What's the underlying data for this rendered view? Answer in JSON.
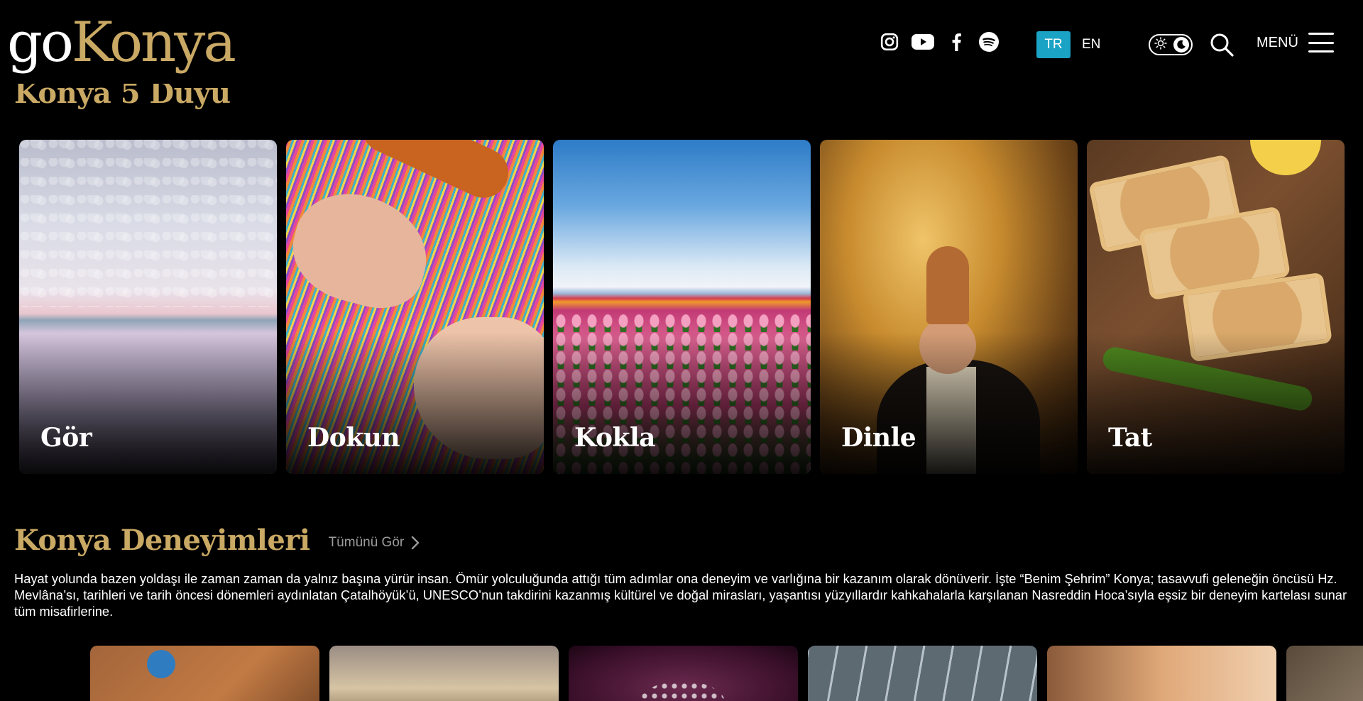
{
  "header": {
    "logo_go": "go",
    "logo_konya": "Konya",
    "social": [
      "instagram-icon",
      "youtube-icon",
      "facebook-icon",
      "spotify-icon"
    ],
    "lang_active": "TR",
    "lang_other": "EN",
    "theme_toggle": "dark",
    "menu_label": "MENÜ"
  },
  "section1": {
    "title": "Konya 5 Duyu",
    "cards": [
      {
        "label": "Gör"
      },
      {
        "label": "Dokun"
      },
      {
        "label": "Kokla"
      },
      {
        "label": "Dinle"
      },
      {
        "label": "Tat"
      }
    ]
  },
  "section2": {
    "title": "Konya Deneyimleri",
    "see_all": "Tümünü Gör",
    "description": "Hayat yolunda bazen yoldaşı ile zaman zaman da yalnız başına yürür insan. Ömür yolculuğunda attığı tüm adımlar ona deneyim ve varlığına bir kazanım olarak dönüverir. İşte “Benim Şehrim” Konya; tasavvufi geleneğin öncüsü Hz. Mevlâna’sı, tarihleri ve tarih öncesi dönemleri aydınlatan Çatalhöyük’ü, UNESCO’nun takdirini kazanmış kültürel ve doğal mirasları, yaşantısı yüzyıllardır kahkahalarla karşılanan Nasreddin Hoca’sıyla eşsiz bir deneyim kartelası sunar tüm misafirlerine."
  },
  "colors": {
    "gold": "#c9a964",
    "accent": "#1ba3c5",
    "background": "#000000"
  }
}
